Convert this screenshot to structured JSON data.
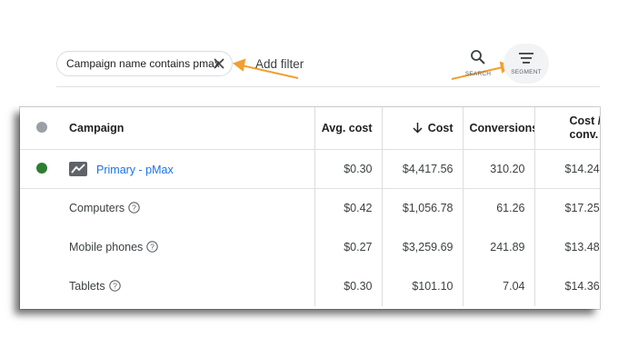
{
  "filter": {
    "chip_label": "Campaign name contains pmax",
    "add_filter_label": "Add filter"
  },
  "toolbar": {
    "search_label": "SEARCH",
    "segment_label": "SEGMENT"
  },
  "table": {
    "headers": {
      "campaign": "Campaign",
      "avg_cost": "Avg. cost",
      "cost": "Cost",
      "conversions": "Conversions",
      "cost_per_conv_line1": "Cost /",
      "cost_per_conv_line2": "conv."
    },
    "main_row": {
      "status_color": "#2e7d32",
      "campaign": "Primary - pMax",
      "avg_cost": "$0.30",
      "cost": "$4,417.56",
      "conversions": "310.20",
      "cost_per_conv": "$14.24"
    },
    "segments": [
      {
        "label": "Computers",
        "avg_cost": "$0.42",
        "cost": "$1,056.78",
        "conversions": "61.26",
        "cost_per_conv": "$17.25"
      },
      {
        "label": "Mobile phones",
        "avg_cost": "$0.27",
        "cost": "$3,259.69",
        "conversions": "241.89",
        "cost_per_conv": "$13.48"
      },
      {
        "label": "Tablets",
        "avg_cost": "$0.30",
        "cost": "$101.10",
        "conversions": "7.04",
        "cost_per_conv": "$14.36"
      }
    ]
  },
  "colors": {
    "annotation_arrow": "#f0a030",
    "link": "#1a73e8",
    "status_header_dot": "#9aa0a6"
  }
}
